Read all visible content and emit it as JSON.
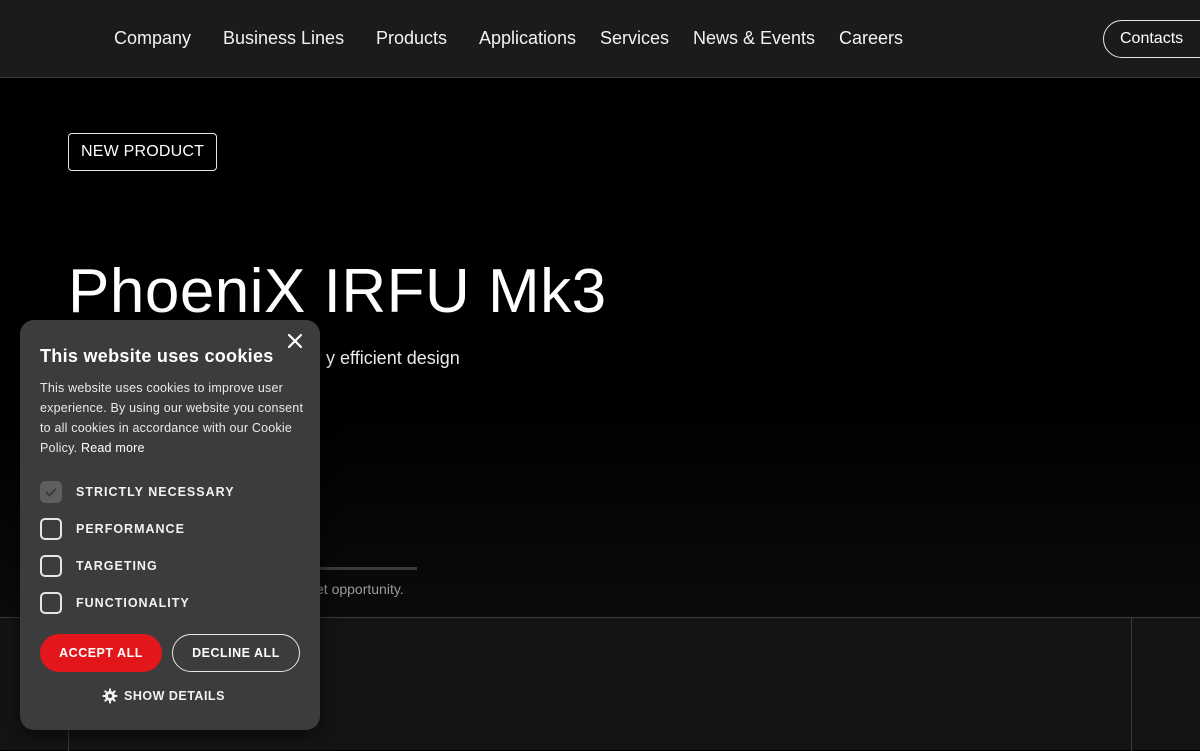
{
  "nav": {
    "items": [
      {
        "label": "Company"
      },
      {
        "label": "Business Lines"
      },
      {
        "label": "Products"
      },
      {
        "label": "Applications"
      },
      {
        "label": "Services"
      },
      {
        "label": "News & Events"
      },
      {
        "label": "Careers"
      }
    ],
    "contacts_label": "Contacts"
  },
  "hero": {
    "badge": "NEW PRODUCT",
    "title": "PhoeniX IRFU Mk3",
    "subtitle_visible": "y efficient design",
    "caption_visible": "et opportunity.",
    "progress": 0.72
  },
  "cookie": {
    "title": "This website uses cookies",
    "body": "This website uses cookies to improve user experience. By using our website you consent to all cookies in accordance with our Cookie Policy.",
    "read_more": "Read more",
    "options": [
      {
        "label": "STRICTLY NECESSARY",
        "checked": true
      },
      {
        "label": "PERFORMANCE",
        "checked": false
      },
      {
        "label": "TARGETING",
        "checked": false
      },
      {
        "label": "FUNCTIONALITY",
        "checked": false
      }
    ],
    "accept_label": "ACCEPT ALL",
    "decline_label": "DECLINE ALL",
    "details_label": "SHOW DETAILS",
    "close_icon": "close-icon",
    "details_icon": "gear-icon"
  },
  "colors": {
    "accent_red": "#e3171b",
    "header_bg": "#1b1b1b",
    "modal_bg": "#3c3c3c"
  }
}
